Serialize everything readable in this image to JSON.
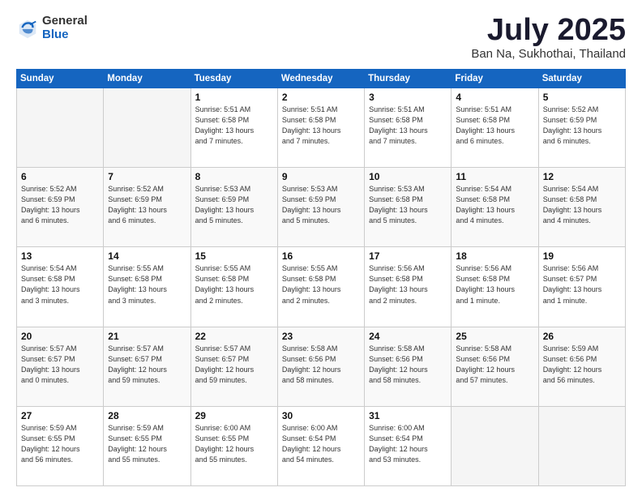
{
  "header": {
    "logo_general": "General",
    "logo_blue": "Blue",
    "month_title": "July 2025",
    "location": "Ban Na, Sukhothai, Thailand"
  },
  "days_of_week": [
    "Sunday",
    "Monday",
    "Tuesday",
    "Wednesday",
    "Thursday",
    "Friday",
    "Saturday"
  ],
  "weeks": [
    {
      "shade": false,
      "days": [
        {
          "num": "",
          "info": ""
        },
        {
          "num": "",
          "info": ""
        },
        {
          "num": "1",
          "info": "Sunrise: 5:51 AM\nSunset: 6:58 PM\nDaylight: 13 hours\nand 7 minutes."
        },
        {
          "num": "2",
          "info": "Sunrise: 5:51 AM\nSunset: 6:58 PM\nDaylight: 13 hours\nand 7 minutes."
        },
        {
          "num": "3",
          "info": "Sunrise: 5:51 AM\nSunset: 6:58 PM\nDaylight: 13 hours\nand 7 minutes."
        },
        {
          "num": "4",
          "info": "Sunrise: 5:51 AM\nSunset: 6:58 PM\nDaylight: 13 hours\nand 6 minutes."
        },
        {
          "num": "5",
          "info": "Sunrise: 5:52 AM\nSunset: 6:59 PM\nDaylight: 13 hours\nand 6 minutes."
        }
      ]
    },
    {
      "shade": true,
      "days": [
        {
          "num": "6",
          "info": "Sunrise: 5:52 AM\nSunset: 6:59 PM\nDaylight: 13 hours\nand 6 minutes."
        },
        {
          "num": "7",
          "info": "Sunrise: 5:52 AM\nSunset: 6:59 PM\nDaylight: 13 hours\nand 6 minutes."
        },
        {
          "num": "8",
          "info": "Sunrise: 5:53 AM\nSunset: 6:59 PM\nDaylight: 13 hours\nand 5 minutes."
        },
        {
          "num": "9",
          "info": "Sunrise: 5:53 AM\nSunset: 6:59 PM\nDaylight: 13 hours\nand 5 minutes."
        },
        {
          "num": "10",
          "info": "Sunrise: 5:53 AM\nSunset: 6:58 PM\nDaylight: 13 hours\nand 5 minutes."
        },
        {
          "num": "11",
          "info": "Sunrise: 5:54 AM\nSunset: 6:58 PM\nDaylight: 13 hours\nand 4 minutes."
        },
        {
          "num": "12",
          "info": "Sunrise: 5:54 AM\nSunset: 6:58 PM\nDaylight: 13 hours\nand 4 minutes."
        }
      ]
    },
    {
      "shade": false,
      "days": [
        {
          "num": "13",
          "info": "Sunrise: 5:54 AM\nSunset: 6:58 PM\nDaylight: 13 hours\nand 3 minutes."
        },
        {
          "num": "14",
          "info": "Sunrise: 5:55 AM\nSunset: 6:58 PM\nDaylight: 13 hours\nand 3 minutes."
        },
        {
          "num": "15",
          "info": "Sunrise: 5:55 AM\nSunset: 6:58 PM\nDaylight: 13 hours\nand 2 minutes."
        },
        {
          "num": "16",
          "info": "Sunrise: 5:55 AM\nSunset: 6:58 PM\nDaylight: 13 hours\nand 2 minutes."
        },
        {
          "num": "17",
          "info": "Sunrise: 5:56 AM\nSunset: 6:58 PM\nDaylight: 13 hours\nand 2 minutes."
        },
        {
          "num": "18",
          "info": "Sunrise: 5:56 AM\nSunset: 6:58 PM\nDaylight: 13 hours\nand 1 minute."
        },
        {
          "num": "19",
          "info": "Sunrise: 5:56 AM\nSunset: 6:57 PM\nDaylight: 13 hours\nand 1 minute."
        }
      ]
    },
    {
      "shade": true,
      "days": [
        {
          "num": "20",
          "info": "Sunrise: 5:57 AM\nSunset: 6:57 PM\nDaylight: 13 hours\nand 0 minutes."
        },
        {
          "num": "21",
          "info": "Sunrise: 5:57 AM\nSunset: 6:57 PM\nDaylight: 12 hours\nand 59 minutes."
        },
        {
          "num": "22",
          "info": "Sunrise: 5:57 AM\nSunset: 6:57 PM\nDaylight: 12 hours\nand 59 minutes."
        },
        {
          "num": "23",
          "info": "Sunrise: 5:58 AM\nSunset: 6:56 PM\nDaylight: 12 hours\nand 58 minutes."
        },
        {
          "num": "24",
          "info": "Sunrise: 5:58 AM\nSunset: 6:56 PM\nDaylight: 12 hours\nand 58 minutes."
        },
        {
          "num": "25",
          "info": "Sunrise: 5:58 AM\nSunset: 6:56 PM\nDaylight: 12 hours\nand 57 minutes."
        },
        {
          "num": "26",
          "info": "Sunrise: 5:59 AM\nSunset: 6:56 PM\nDaylight: 12 hours\nand 56 minutes."
        }
      ]
    },
    {
      "shade": false,
      "days": [
        {
          "num": "27",
          "info": "Sunrise: 5:59 AM\nSunset: 6:55 PM\nDaylight: 12 hours\nand 56 minutes."
        },
        {
          "num": "28",
          "info": "Sunrise: 5:59 AM\nSunset: 6:55 PM\nDaylight: 12 hours\nand 55 minutes."
        },
        {
          "num": "29",
          "info": "Sunrise: 6:00 AM\nSunset: 6:55 PM\nDaylight: 12 hours\nand 55 minutes."
        },
        {
          "num": "30",
          "info": "Sunrise: 6:00 AM\nSunset: 6:54 PM\nDaylight: 12 hours\nand 54 minutes."
        },
        {
          "num": "31",
          "info": "Sunrise: 6:00 AM\nSunset: 6:54 PM\nDaylight: 12 hours\nand 53 minutes."
        },
        {
          "num": "",
          "info": ""
        },
        {
          "num": "",
          "info": ""
        }
      ]
    }
  ]
}
